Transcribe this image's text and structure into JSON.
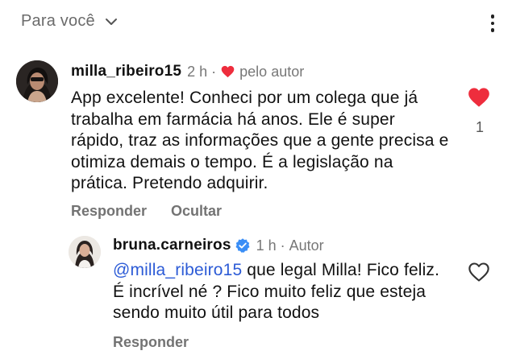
{
  "header": {
    "filter_label": "Para você"
  },
  "comments": [
    {
      "username": "milla_ribeiro15",
      "time": "2 h",
      "liked_by_author_label": "pelo autor",
      "text": "App excelente! Conheci por um colega que já trabalha em farmácia há anos. Ele é super rápido, traz as informações que a gente precisa e otimiza demais o tempo. É a legislação na prática. Pretendo adquirir.",
      "like_count": "1",
      "liked": true,
      "actions": {
        "reply": "Responder",
        "hide": "Ocultar"
      }
    },
    {
      "username": "bruna.carneiros",
      "verified": true,
      "time": "1 h",
      "author_label": "Autor",
      "mention": "@milla_ribeiro15",
      "text": " que legal Milla! Fico feliz. É incrível né ? Fico muito feliz que esteja sendo muito útil para todos",
      "liked": false,
      "actions": {
        "reply": "Responder"
      }
    }
  ],
  "icons": {
    "filter": "chevron-down-icon",
    "menu": "more-vertical-icon",
    "like": "heart-icon",
    "verified": "verified-badge-icon"
  },
  "colors": {
    "heart": "#ee2d3d",
    "mention": "#2c5bd6",
    "verified": "#3a8ef6",
    "muted": "#737373"
  }
}
